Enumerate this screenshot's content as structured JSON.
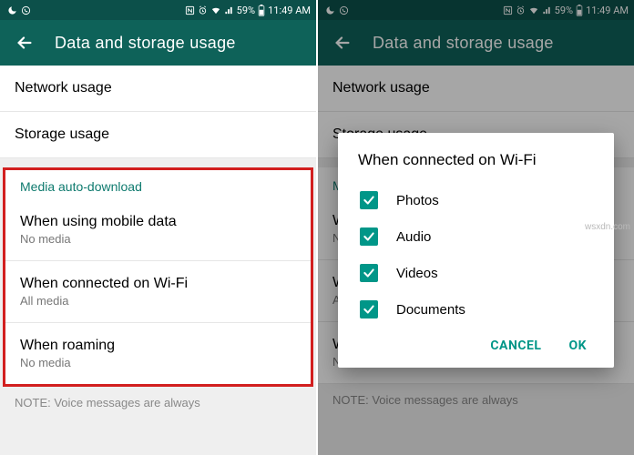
{
  "statusbar": {
    "battery_pct": "59%",
    "time": "11:49 AM"
  },
  "appbar": {
    "title": "Data and storage usage"
  },
  "rows": {
    "network_usage": "Network usage",
    "storage_usage": "Storage usage"
  },
  "media_section": {
    "header": "Media auto-download",
    "mobile": {
      "title": "When using mobile data",
      "sub": "No media"
    },
    "wifi": {
      "title": "When connected on Wi-Fi",
      "sub": "All media"
    },
    "roaming": {
      "title": "When roaming",
      "sub": "No media"
    }
  },
  "note": "NOTE: Voice messages are always",
  "dialog": {
    "title": "When connected on Wi-Fi",
    "options": {
      "photos": "Photos",
      "audio": "Audio",
      "videos": "Videos",
      "documents": "Documents"
    },
    "cancel": "CANCEL",
    "ok": "OK"
  },
  "watermark": "wsxdn.com"
}
